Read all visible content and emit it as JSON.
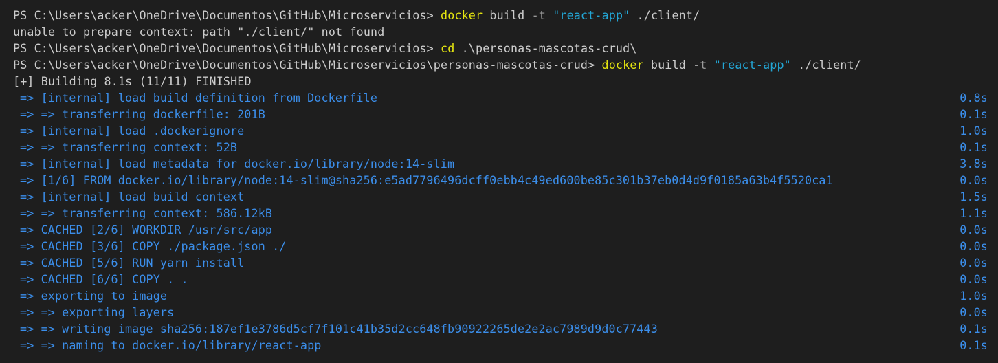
{
  "terminal": {
    "colors": {
      "background": "#1e1e1e",
      "text": "#cccccc",
      "command": "#e5e510",
      "flag": "#999999",
      "string": "#23a6d5",
      "build_step": "#3b8eea"
    },
    "prompt_lines": [
      {
        "prompt": "PS C:\\Users\\acker\\OneDrive\\Documentos\\GitHub\\Microservicios> ",
        "command": "docker",
        "arg1": " build ",
        "flag": "-t",
        "space": " ",
        "string": "\"react-app\"",
        "rest": " ./client/"
      }
    ],
    "error_line": "unable to prepare context: path \"./client/\" not found",
    "cd_line": {
      "prompt": "PS C:\\Users\\acker\\OneDrive\\Documentos\\GitHub\\Microservicios> ",
      "command": "cd",
      "rest": " .\\personas-mascotas-crud\\"
    },
    "build_line": {
      "prompt": "PS C:\\Users\\acker\\OneDrive\\Documentos\\GitHub\\Microservicios\\personas-mascotas-crud> ",
      "command": "docker",
      "arg1": " build ",
      "flag": "-t",
      "space": " ",
      "string": "\"react-app\"",
      "rest": " ./client/"
    },
    "building_status": "[+] Building 8.1s (11/11) FINISHED",
    "steps": [
      {
        "text": "=> [internal] load build definition from Dockerfile",
        "time": "0.8s"
      },
      {
        "text": "=> => transferring dockerfile: 201B",
        "time": "0.1s"
      },
      {
        "text": "=> [internal] load .dockerignore",
        "time": "1.0s"
      },
      {
        "text": "=> => transferring context: 52B",
        "time": "0.1s"
      },
      {
        "text": "=> [internal] load metadata for docker.io/library/node:14-slim",
        "time": "3.8s"
      },
      {
        "text": "=> [1/6] FROM docker.io/library/node:14-slim@sha256:e5ad7796496dcff0ebb4c49ed600be85c301b37eb0d4d9f0185a63b4f5520ca1",
        "time": "0.0s"
      },
      {
        "text": "=> [internal] load build context",
        "time": "1.5s"
      },
      {
        "text": "=> => transferring context: 586.12kB",
        "time": "1.1s"
      },
      {
        "text": "=> CACHED [2/6] WORKDIR /usr/src/app",
        "time": "0.0s"
      },
      {
        "text": "=> CACHED [3/6] COPY ./package.json ./",
        "time": "0.0s"
      },
      {
        "text": "=> CACHED [5/6] RUN yarn install",
        "time": "0.0s"
      },
      {
        "text": "=> CACHED [6/6] COPY . .",
        "time": "0.0s"
      },
      {
        "text": "=> exporting to image",
        "time": "1.0s"
      },
      {
        "text": "=> => exporting layers",
        "time": "0.0s"
      },
      {
        "text": "=> => writing image sha256:187ef1e3786d5cf7f101c41b35d2cc648fb90922265de2e2ac7989d9d0c77443",
        "time": "0.1s"
      },
      {
        "text": "=> => naming to docker.io/library/react-app",
        "time": "0.1s"
      }
    ]
  }
}
